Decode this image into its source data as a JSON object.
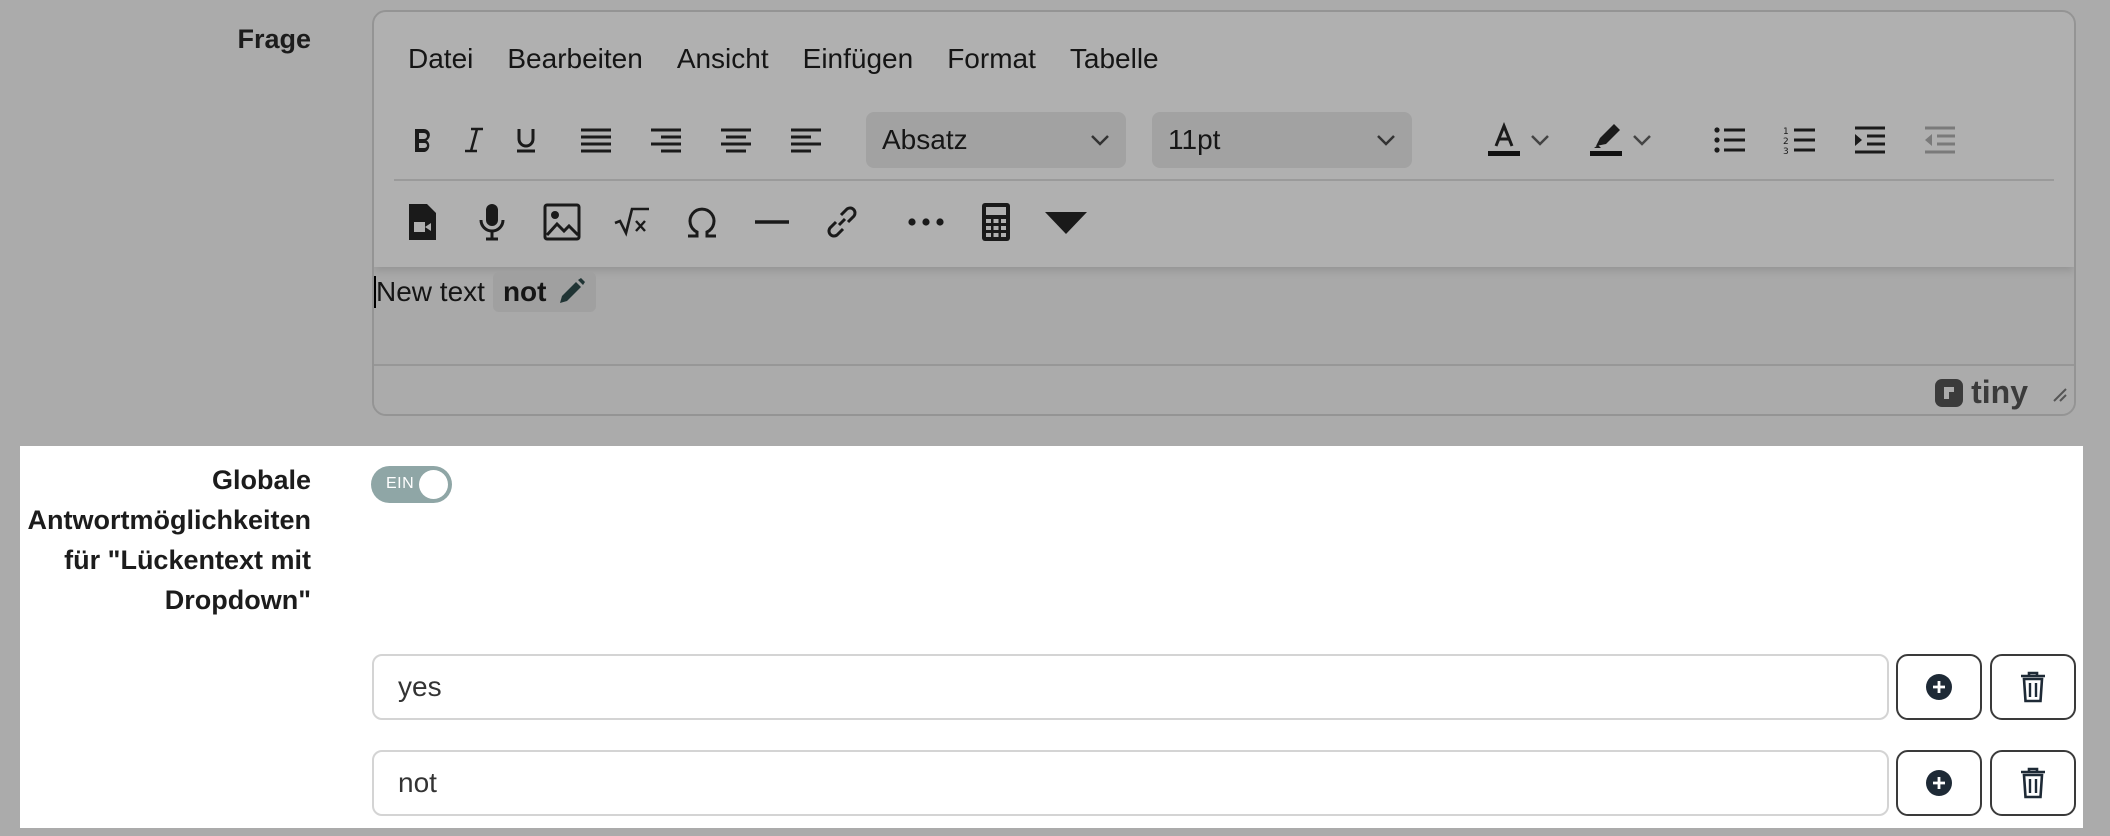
{
  "frage_label": "Frage",
  "editor": {
    "menu": [
      "Datei",
      "Bearbeiten",
      "Ansicht",
      "Einfügen",
      "Format",
      "Tabelle"
    ],
    "block_format": "Absatz",
    "font_size": "11pt",
    "content_text": "New text",
    "gap_text": "not",
    "brand": "tiny"
  },
  "global_options_label": "Globale Antwortmöglichkeiten für \"Lückentext mit Dropdown\"",
  "toggle": {
    "label": "EIN",
    "checked": true
  },
  "answers": [
    {
      "value": "yes"
    },
    {
      "value": "not"
    }
  ],
  "colors": {
    "toggle_on": "#8fa6a6",
    "overlay": "#ababab",
    "panel": "#ffffff"
  }
}
